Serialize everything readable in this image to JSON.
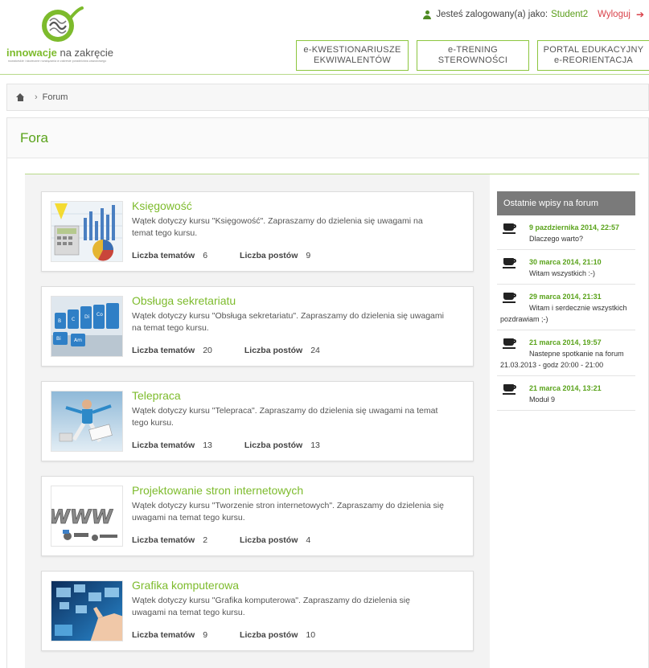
{
  "header": {
    "logo_bold": "innowacje",
    "logo_rest": " na zakręcie",
    "logo_tagline": "nowatorskie i skuteczne rozwiązania w zakresie poradnictwa zawodowego",
    "user_prefix": "Jesteś zalogowany(a) jako:",
    "user_name": "Student2",
    "logout_label": "Wyloguj",
    "nav": [
      {
        "line1": "e-KWESTIONARIUSZE",
        "line2": "EKWIWALENTÓW"
      },
      {
        "line1": "e-TRENING",
        "line2": "STEROWNOŚCI"
      },
      {
        "line1": "PORTAL EDUKACYJNY",
        "line2": "e-REORIENTACJA"
      }
    ]
  },
  "breadcrumb": {
    "separator": "›",
    "current": "Forum"
  },
  "page": {
    "title": "Fora"
  },
  "forums": [
    {
      "title": "Księgowość",
      "description": "Wątek dotyczy kursu \"Księgowość\". Zapraszamy do dzielenia się uwagami na temat tego kursu.",
      "topics_label": "Liczba tematów",
      "topics": "6",
      "posts_label": "Liczba postów",
      "posts": "9"
    },
    {
      "title": "Obsługa sekretariatu",
      "description": "Wątek dotyczy kursu \"Obsługa sekretariatu\". Zapraszamy do dzielenia się uwagami na temat tego kursu.",
      "topics_label": "Liczba tematów",
      "topics": "20",
      "posts_label": "Liczba postów",
      "posts": "24"
    },
    {
      "title": "Telepraca",
      "description": "Wątek dotyczy kursu \"Telepraca\". Zapraszamy do dzielenia się uwagami na temat tego kursu.",
      "topics_label": "Liczba tematów",
      "topics": "13",
      "posts_label": "Liczba postów",
      "posts": "13"
    },
    {
      "title": "Projektowanie stron internetowych",
      "description": "Wątek dotyczy kursu \"Tworzenie stron internetowych\". Zapraszamy do dzielenia się uwagami na temat tego kursu.",
      "topics_label": "Liczba tematów",
      "topics": "2",
      "posts_label": "Liczba postów",
      "posts": "4"
    },
    {
      "title": "Grafika komputerowa",
      "description": "Wątek dotyczy kursu \"Grafika komputerowa\". Zapraszamy do dzielenia się uwagami na temat tego kursu.",
      "topics_label": "Liczba tematów",
      "topics": "9",
      "posts_label": "Liczba postów",
      "posts": "10"
    }
  ],
  "sidebar": {
    "title": "Ostatnie wpisy na forum",
    "posts": [
      {
        "date": "9 pazdziernika 2014, 22:57",
        "text": "Dlaczego warto?"
      },
      {
        "date": "30 marca 2014, 21:10",
        "text": "Witam wszystkich :-)"
      },
      {
        "date": "29 marca 2014, 21:31",
        "text": "Witam i serdecznie wszystkich pozdrawiam ;-)"
      },
      {
        "date": "21 marca 2014, 19:57",
        "text": "Nastepne spotkanie na forum 21.03.2013 - godz 20:00 - 21:00"
      },
      {
        "date": "21 marca 2014, 13:21",
        "text": "Moduł 9"
      }
    ]
  },
  "colors": {
    "accent": "#7dbb2c",
    "title_green": "#5aa31b",
    "logout": "#d9414a",
    "sidebar_head": "#7a7a7a"
  }
}
